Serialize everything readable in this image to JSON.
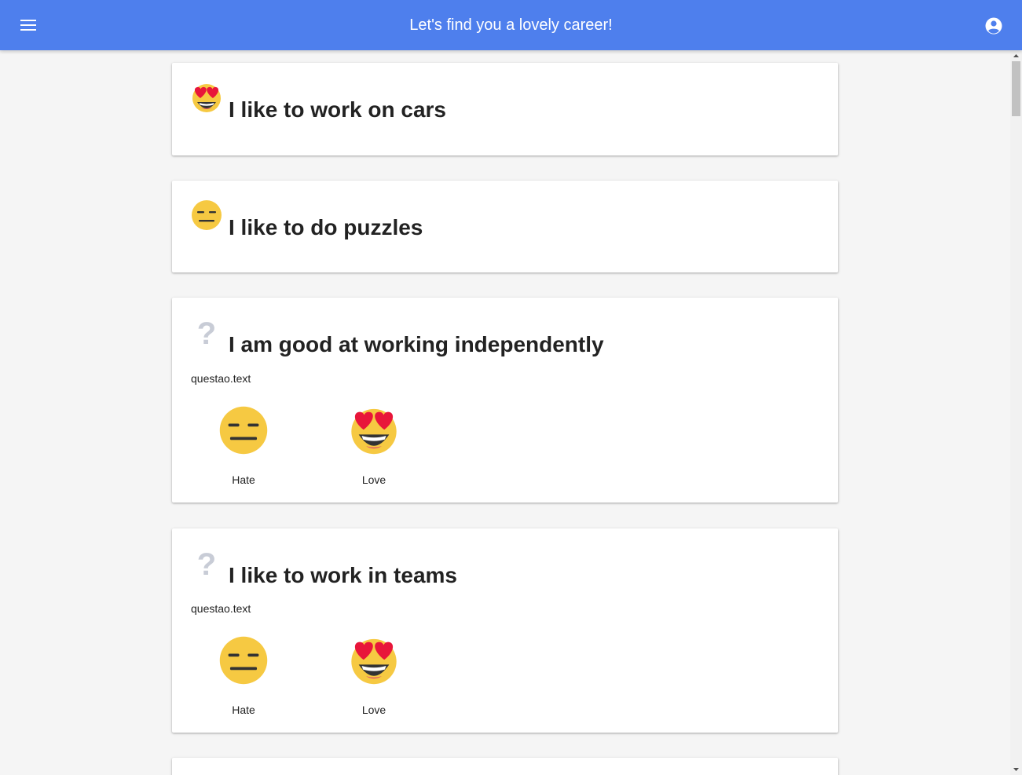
{
  "header": {
    "title": "Let's find you a lovely career!",
    "menu_icon": "hamburger-menu-icon",
    "account_icon": "account-circle-icon",
    "color": "#4e7fed"
  },
  "cards": [
    {
      "title": "I like to work on cars",
      "status": "love",
      "status_icon": "heart-eyes-emoji-icon"
    },
    {
      "title": "I like to do puzzles",
      "status": "hate",
      "status_icon": "neutral-face-emoji-icon"
    },
    {
      "title": "I am good at working independently",
      "status": "unanswered",
      "status_icon": "question-mark-icon",
      "text": "questao.text",
      "choices": [
        {
          "label": "Hate",
          "icon": "neutral-face-emoji-icon"
        },
        {
          "label": "Love",
          "icon": "heart-eyes-emoji-icon"
        }
      ]
    },
    {
      "title": "I like to work in teams",
      "status": "unanswered",
      "status_icon": "question-mark-icon",
      "text": "questao.text",
      "choices": [
        {
          "label": "Hate",
          "icon": "neutral-face-emoji-icon"
        },
        {
          "label": "Love",
          "icon": "heart-eyes-emoji-icon"
        }
      ]
    }
  ]
}
